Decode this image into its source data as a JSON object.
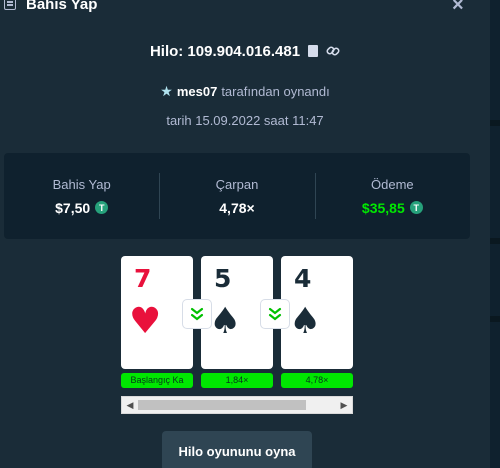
{
  "header": {
    "title": "Bahis Yap",
    "close_label": "×"
  },
  "game": {
    "id": "Hilo: 109.904.016.481"
  },
  "player": {
    "name": "mes07",
    "suffix": "tarafından oynandı"
  },
  "date": "tarih 15.09.2022 saat 11:47",
  "stats": {
    "bet": {
      "label": "Bahis Yap",
      "value": "$7,50"
    },
    "multiplier": {
      "label": "Çarpan",
      "value": "4,78×"
    },
    "payout": {
      "label": "Ödeme",
      "value": "$35,85"
    }
  },
  "cards": [
    {
      "rank": "7",
      "suit": "♥",
      "color": "red",
      "label": "Başlangıç Ka"
    },
    {
      "rank": "5",
      "suit": "♠",
      "color": "black",
      "label": "1,84×"
    },
    {
      "rank": "4",
      "suit": "♠",
      "color": "black",
      "label": "4,78×"
    }
  ],
  "play_button": "Hilo oyununu oyna",
  "colors": {
    "background": "#1a2c38",
    "panel": "#0f212e",
    "accent_green": "#00e701",
    "card_red": "#e9113c",
    "button": "#2f4553"
  },
  "icons": [
    "list-icon",
    "close-icon",
    "copy-icon",
    "link-icon",
    "star-icon",
    "tether-coin-icon",
    "chevron-down-icon"
  ]
}
